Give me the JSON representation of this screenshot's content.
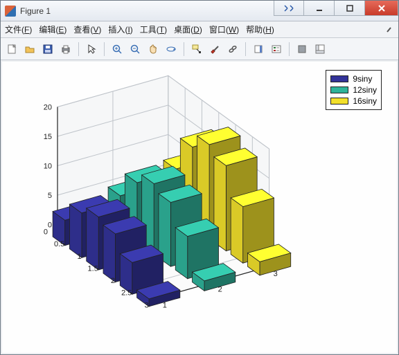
{
  "window": {
    "title": "Figure 1"
  },
  "menu": {
    "file": {
      "label": "文件",
      "hotkey": "F"
    },
    "edit": {
      "label": "编辑",
      "hotkey": "E"
    },
    "view": {
      "label": "查看",
      "hotkey": "V"
    },
    "insert": {
      "label": "插入",
      "hotkey": "I"
    },
    "tools": {
      "label": "工具",
      "hotkey": "T"
    },
    "desktop": {
      "label": "桌面",
      "hotkey": "D"
    },
    "window": {
      "label": "窗口",
      "hotkey": "W"
    },
    "help": {
      "label": "帮助",
      "hotkey": "H"
    }
  },
  "legend": {
    "s1": "9siny",
    "s2": "12siny",
    "s3": "16siny"
  },
  "colors": {
    "s1": "#333399",
    "s2": "#2fb39a",
    "s3": "#f2e02b",
    "edge": "#222222",
    "grid": "#bfc4ca",
    "axis": "#222222"
  },
  "chart_data": {
    "type": "bar",
    "subtype": "bar3d-grouped",
    "title": "",
    "xlabel": "",
    "ylabel": "",
    "zlabel": "",
    "x": [
      0.5,
      1.0,
      1.5,
      2.0,
      2.5,
      3.0
    ],
    "x_ticks": [
      0,
      0.5,
      1,
      1.5,
      2,
      2.5,
      3
    ],
    "y_categories": [
      1,
      2,
      3
    ],
    "y_ticks": [
      1,
      2,
      3
    ],
    "z_ticks": [
      0,
      5,
      10,
      15,
      20
    ],
    "zlim": [
      0,
      20
    ],
    "xlim": [
      0,
      3
    ],
    "ylim": [
      1,
      3
    ],
    "legend_position": "northeast",
    "series": [
      {
        "name": "9siny",
        "color": "#333399",
        "values": [
          4.3,
          7.6,
          9.0,
          8.2,
          5.4,
          1.3
        ]
      },
      {
        "name": "12siny",
        "color": "#2fb39a",
        "values": [
          5.8,
          10.1,
          12.0,
          10.9,
          7.2,
          1.7
        ]
      },
      {
        "name": "16siny",
        "color": "#f2e02b",
        "values": [
          7.7,
          13.5,
          16.0,
          14.5,
          9.6,
          2.3
        ]
      }
    ]
  }
}
